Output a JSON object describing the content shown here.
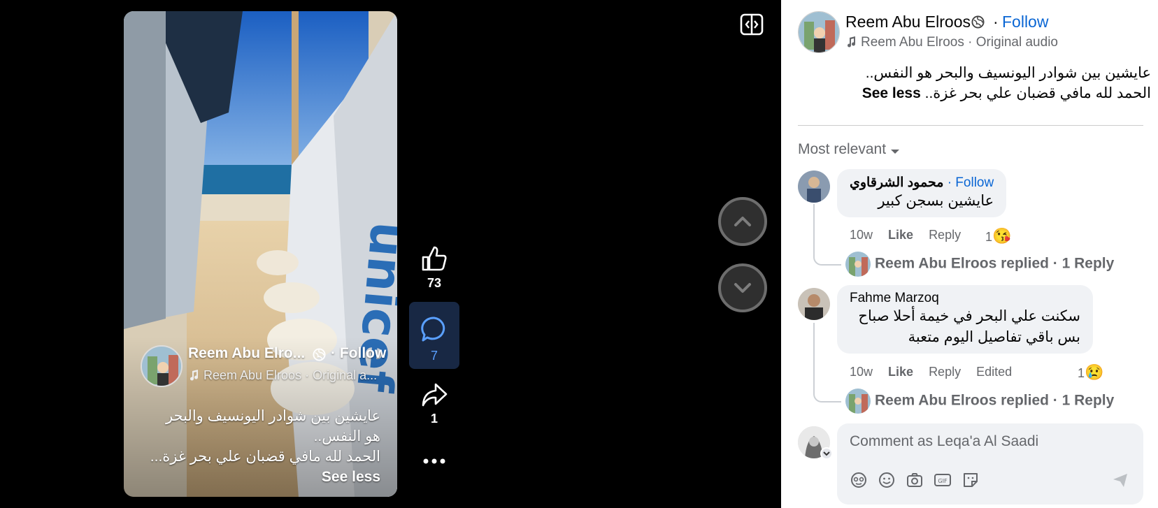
{
  "post": {
    "author": "Reem Abu Elroos",
    "author_truncated": "Reem Abu Elro...",
    "follow_label": "Follow",
    "audio_label": "Reem Abu Elroos · Original audio",
    "audio_truncated": "Reem Abu Elroos · Original a...",
    "caption_line1": "عايشين بين شوادر اليونسيف والبحر هو النفس..",
    "caption_line2": "الحمد لله مافي قضبان علي بحر غزة..",
    "overlay_caption_line1": "عايشين بين شوادر اليونسيف والبحر",
    "overlay_caption_line2": "هو النفس..",
    "overlay_caption_line3": "الحمد لله مافي قضبان علي بحر غزة...",
    "see_less": "See less"
  },
  "actions": {
    "likes": "73",
    "comments": "7",
    "shares": "1"
  },
  "comments_section": {
    "sort_label": "Most relevant",
    "comments": [
      {
        "author": "محمود الشرقاوي",
        "follow_label": "· Follow",
        "text": "عايشين بسجن كبير",
        "time": "10w",
        "like": "Like",
        "reply": "Reply",
        "reaction_count": "1",
        "reaction": "😘",
        "replied": "Reem Abu Elroos replied · 1 Reply"
      },
      {
        "author": "Fahme Marzoq",
        "text_line1": "سكنت علي البحر في خيمة أحلا صباح",
        "text_line2": "بس باقي تفاصيل اليوم متعبة",
        "time": "10w",
        "like": "Like",
        "reply": "Reply",
        "edited": "Edited",
        "reaction_count": "1",
        "reaction": "😢",
        "replied": "Reem Abu Elroos replied · 1 Reply"
      }
    ]
  },
  "composer": {
    "placeholder": "Comment as Leqa'a Al Saadi"
  },
  "colors": {
    "accent": "#0a66d4",
    "panel_bg": "#ffffff",
    "viewer_bg": "#000000",
    "bubble_bg": "#f0f2f5"
  }
}
